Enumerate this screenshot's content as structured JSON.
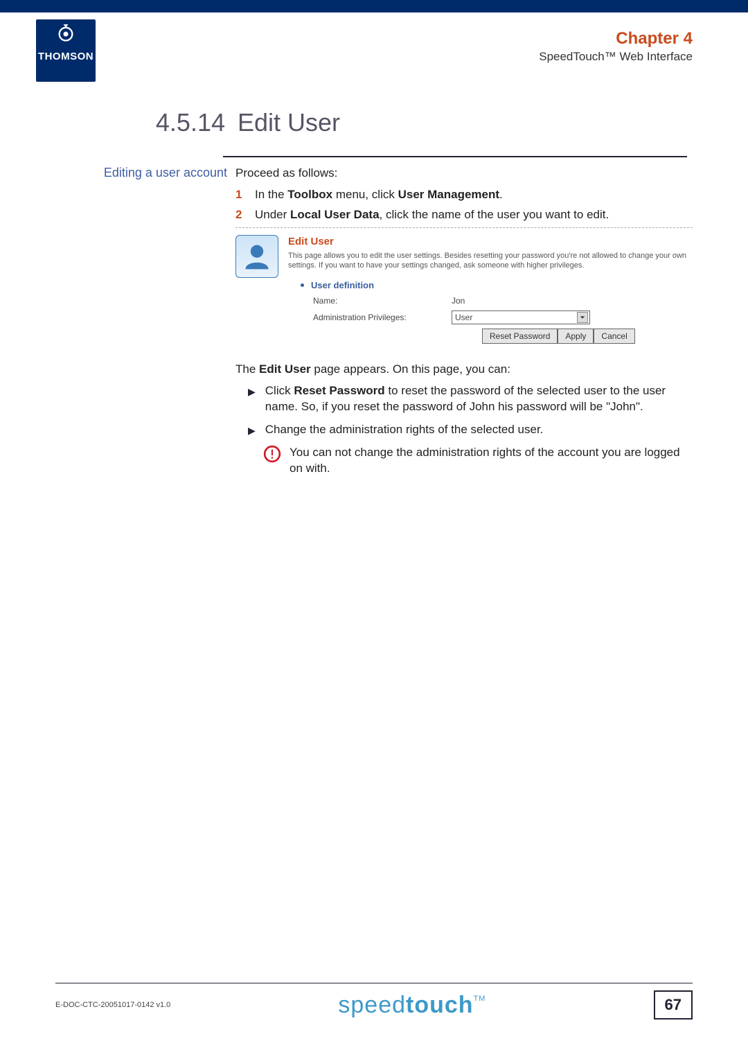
{
  "header": {
    "logo_text": "THOMSON",
    "chapter": "Chapter 4",
    "subtitle": "SpeedTouch™ Web Interface"
  },
  "section": {
    "number": "4.5.14",
    "title": "Edit User"
  },
  "sidebar_label": "Editing a user account",
  "intro": "Proceed as follows:",
  "steps": [
    {
      "num": "1",
      "pre": "In the ",
      "b1": "Toolbox",
      "mid": " menu, click ",
      "b2": "User Management",
      "post": "."
    },
    {
      "num": "2",
      "pre": "Under ",
      "b1": "Local User Data",
      "mid": ", click the name of the user you want to edit.",
      "b2": "",
      "post": ""
    }
  ],
  "screenshot": {
    "title": "Edit User",
    "desc": "This page allows you to edit the user settings. Besides resetting your password you're not allowed to change your own settings. If you want to have your settings changed, ask someone with higher privileges.",
    "user_definition_label": "User definition",
    "name_label": "Name:",
    "name_value": "Jon",
    "priv_label": "Administration Privileges:",
    "priv_value": "User",
    "buttons": {
      "reset": "Reset Password",
      "apply": "Apply",
      "cancel": "Cancel"
    }
  },
  "after_text_pre": "The ",
  "after_text_b": "Edit User",
  "after_text_post": " page appears. On this page, you can:",
  "bullets": [
    {
      "pre": "Click ",
      "b": "Reset Password",
      "post": " to reset the password of the selected user to the user name. So, if you reset the password of John his password will be \"John\"."
    },
    {
      "pre": "",
      "b": "",
      "post": "Change the administration rights of the selected user."
    }
  ],
  "warning": "You can not change the administration rights of the account you are logged on with.",
  "footer": {
    "doc_id": "E-DOC-CTC-20051017-0142 v1.0",
    "brand1": "speed",
    "brand2": "touch",
    "tm": "TM",
    "page": "67"
  }
}
